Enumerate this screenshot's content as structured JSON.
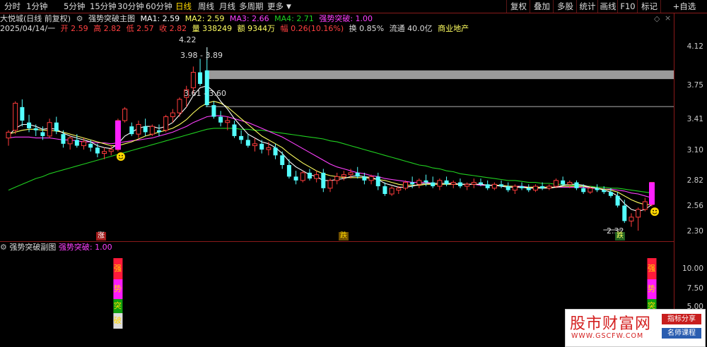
{
  "toolbar": {
    "tabs": [
      "分时",
      "1分钟",
      "5分钟",
      "15分钟",
      "30分钟",
      "60分钟",
      "日线",
      "周线",
      "月线",
      "多周期",
      "更多"
    ],
    "active_tab": "日线",
    "buttons": [
      "复权",
      "叠加",
      "多股",
      "统计",
      "画线",
      "F10",
      "标记",
      "+自选"
    ]
  },
  "header": {
    "stock": "大悦城(日线 前复权)",
    "indicator": "强势突破主图",
    "ma1": "MA1: 2.59",
    "ma2": "MA2: 2.59",
    "ma3": "MA3: 2.66",
    "ma4": "MA4: 2.71",
    "breakout": "强势突破: 1.00"
  },
  "quote": {
    "date": "2025/04/14/一",
    "open": "开 2.59",
    "high": "高 2.82",
    "low": "低 2.57",
    "close": "收 2.82",
    "volume": "量 338249",
    "amount": "额 9344万",
    "change": "幅 0.26(10.16%)",
    "turnover": "换 0.85%",
    "float": "流通 40.0亿",
    "sector": "商业地产"
  },
  "axis": {
    "main_ticks": [
      "4.12",
      "3.75",
      "3.41",
      "3.10",
      "2.82",
      "2.56",
      "2.30"
    ],
    "sub_ticks": [
      "10.00",
      "7.50",
      "5.00"
    ]
  },
  "annotations": {
    "high_label": "4.22",
    "zone1": "3.98 - 3.89",
    "zone2": "3.61 - 3.60",
    "low_label": "2.32",
    "marker_up": "涨",
    "marker_mid": "跌",
    "marker_down": "跌"
  },
  "sub": {
    "title": "强势突破副图",
    "value": "强势突破: 1.00",
    "bar_chars": [
      "强",
      "势",
      "突",
      "破"
    ]
  },
  "watermark": {
    "title": "股市财富网",
    "url": "WWW.GSCFW.COM",
    "tag1": "指标分享",
    "tag2": "名师课程"
  },
  "colors": {
    "up": "#ff3c3c",
    "down": "#54ffff",
    "ma1": "#ffffff",
    "ma2": "#ffff60",
    "ma3": "#ff40ff",
    "ma4": "#20d020",
    "grid_red": "#8a1a1a"
  },
  "chart_data": {
    "type": "candlestick",
    "price_range": [
      2.2,
      4.3
    ],
    "ohlc": [
      [
        3.28,
        3.36,
        3.2,
        3.34
      ],
      [
        3.36,
        3.66,
        3.32,
        3.64
      ],
      [
        3.6,
        3.68,
        3.4,
        3.46
      ],
      [
        3.44,
        3.52,
        3.34,
        3.38
      ],
      [
        3.38,
        3.42,
        3.3,
        3.36
      ],
      [
        3.34,
        3.4,
        3.26,
        3.3
      ],
      [
        3.3,
        3.48,
        3.28,
        3.44
      ],
      [
        3.44,
        3.5,
        3.32,
        3.35
      ],
      [
        3.32,
        3.36,
        3.18,
        3.22
      ],
      [
        3.22,
        3.3,
        3.16,
        3.28
      ],
      [
        3.26,
        3.32,
        3.18,
        3.2
      ],
      [
        3.2,
        3.28,
        3.16,
        3.24
      ],
      [
        3.22,
        3.26,
        3.14,
        3.18
      ],
      [
        3.18,
        3.22,
        3.08,
        3.12
      ],
      [
        3.12,
        3.18,
        3.06,
        3.14
      ],
      [
        3.14,
        3.2,
        3.1,
        3.16
      ],
      [
        3.16,
        3.48,
        3.14,
        3.46
      ],
      [
        3.46,
        3.6,
        3.44,
        3.58
      ],
      [
        3.4,
        3.44,
        3.3,
        3.32
      ],
      [
        3.32,
        3.46,
        3.28,
        3.42
      ],
      [
        3.4,
        3.48,
        3.3,
        3.34
      ],
      [
        3.32,
        3.42,
        3.3,
        3.4
      ],
      [
        3.36,
        3.42,
        3.3,
        3.34
      ],
      [
        3.36,
        3.52,
        3.34,
        3.5
      ],
      [
        3.5,
        3.58,
        3.44,
        3.54
      ],
      [
        3.54,
        3.7,
        3.5,
        3.68
      ],
      [
        3.7,
        3.82,
        3.6,
        3.78
      ],
      [
        3.8,
        4.02,
        3.74,
        3.96
      ],
      [
        3.96,
        4.1,
        3.82,
        3.84
      ],
      [
        3.98,
        4.22,
        3.6,
        3.62
      ],
      [
        3.62,
        3.66,
        3.48,
        3.5
      ],
      [
        3.5,
        3.56,
        3.4,
        3.44
      ],
      [
        3.44,
        3.5,
        3.36,
        3.46
      ],
      [
        3.42,
        3.46,
        3.28,
        3.3
      ],
      [
        3.3,
        3.36,
        3.22,
        3.26
      ],
      [
        3.26,
        3.32,
        3.18,
        3.2
      ],
      [
        3.2,
        3.28,
        3.14,
        3.22
      ],
      [
        3.22,
        3.26,
        3.12,
        3.16
      ],
      [
        3.16,
        3.24,
        3.1,
        3.18
      ],
      [
        3.18,
        3.22,
        3.06,
        3.1
      ],
      [
        3.1,
        3.14,
        2.96,
        3.0
      ],
      [
        3.0,
        3.06,
        2.86,
        2.88
      ],
      [
        2.88,
        2.94,
        2.8,
        2.84
      ],
      [
        2.84,
        2.94,
        2.82,
        2.92
      ],
      [
        2.92,
        2.96,
        2.84,
        2.86
      ],
      [
        2.86,
        2.94,
        2.82,
        2.9
      ],
      [
        2.92,
        2.96,
        2.72,
        2.76
      ],
      [
        2.76,
        2.86,
        2.72,
        2.84
      ],
      [
        2.84,
        2.92,
        2.8,
        2.88
      ],
      [
        2.88,
        2.94,
        2.84,
        2.9
      ],
      [
        2.9,
        2.96,
        2.86,
        2.92
      ],
      [
        2.92,
        2.98,
        2.86,
        2.88
      ],
      [
        2.88,
        2.92,
        2.8,
        2.84
      ],
      [
        2.84,
        2.9,
        2.8,
        2.88
      ],
      [
        2.88,
        2.92,
        2.74,
        2.78
      ],
      [
        2.78,
        2.82,
        2.68,
        2.7
      ],
      [
        2.7,
        2.78,
        2.68,
        2.76
      ],
      [
        2.74,
        2.78,
        2.7,
        2.76
      ],
      [
        2.76,
        2.84,
        2.74,
        2.82
      ],
      [
        2.82,
        2.88,
        2.76,
        2.8
      ],
      [
        2.8,
        2.86,
        2.76,
        2.84
      ],
      [
        2.84,
        2.9,
        2.78,
        2.82
      ],
      [
        2.82,
        2.88,
        2.76,
        2.78
      ],
      [
        2.78,
        2.86,
        2.74,
        2.84
      ],
      [
        2.84,
        2.88,
        2.78,
        2.8
      ],
      [
        2.8,
        2.84,
        2.76,
        2.82
      ],
      [
        2.82,
        2.86,
        2.76,
        2.78
      ],
      [
        2.78,
        2.82,
        2.74,
        2.8
      ],
      [
        2.8,
        2.86,
        2.76,
        2.82
      ],
      [
        2.82,
        2.86,
        2.78,
        2.8
      ],
      [
        2.8,
        2.84,
        2.74,
        2.76
      ],
      [
        2.76,
        2.82,
        2.74,
        2.8
      ],
      [
        2.8,
        2.84,
        2.76,
        2.78
      ],
      [
        2.78,
        2.82,
        2.72,
        2.74
      ],
      [
        2.74,
        2.8,
        2.7,
        2.78
      ],
      [
        2.78,
        2.82,
        2.74,
        2.76
      ],
      [
        2.76,
        2.8,
        2.72,
        2.74
      ],
      [
        2.74,
        2.8,
        2.72,
        2.78
      ],
      [
        2.78,
        2.82,
        2.74,
        2.76
      ],
      [
        2.76,
        2.8,
        2.74,
        2.78
      ],
      [
        2.78,
        2.86,
        2.76,
        2.84
      ],
      [
        2.84,
        2.88,
        2.78,
        2.8
      ],
      [
        2.8,
        2.84,
        2.76,
        2.82
      ],
      [
        2.82,
        2.84,
        2.74,
        2.76
      ],
      [
        2.76,
        2.8,
        2.7,
        2.72
      ],
      [
        2.72,
        2.78,
        2.7,
        2.76
      ],
      [
        2.76,
        2.8,
        2.72,
        2.74
      ],
      [
        2.74,
        2.78,
        2.7,
        2.72
      ],
      [
        2.72,
        2.76,
        2.66,
        2.68
      ],
      [
        2.68,
        2.72,
        2.56,
        2.58
      ],
      [
        2.58,
        2.64,
        2.4,
        2.42
      ],
      [
        2.42,
        2.5,
        2.36,
        2.46
      ],
      [
        2.46,
        2.56,
        2.32,
        2.54
      ],
      [
        2.54,
        2.66,
        2.52,
        2.62
      ],
      [
        2.59,
        2.82,
        2.57,
        2.82
      ]
    ],
    "ma1": [
      3.3,
      3.38,
      3.42,
      3.42,
      3.4,
      3.37,
      3.38,
      3.37,
      3.33,
      3.3,
      3.28,
      3.26,
      3.24,
      3.2,
      3.18,
      3.17,
      3.22,
      3.3,
      3.34,
      3.38,
      3.4,
      3.4,
      3.38,
      3.4,
      3.44,
      3.52,
      3.6,
      3.72,
      3.8,
      3.82,
      3.76,
      3.66,
      3.58,
      3.48,
      3.4,
      3.32,
      3.28,
      3.24,
      3.22,
      3.18,
      3.12,
      3.04,
      2.98,
      2.94,
      2.9,
      2.88,
      2.84,
      2.84,
      2.85,
      2.86,
      2.88,
      2.89,
      2.88,
      2.87,
      2.85,
      2.81,
      2.79,
      2.77,
      2.77,
      2.78,
      2.8,
      2.81,
      2.81,
      2.81,
      2.81,
      2.81,
      2.8,
      2.8,
      2.8,
      2.8,
      2.79,
      2.79,
      2.78,
      2.77,
      2.77,
      2.77,
      2.76,
      2.76,
      2.76,
      2.76,
      2.77,
      2.79,
      2.8,
      2.8,
      2.79,
      2.77,
      2.76,
      2.74,
      2.72,
      2.68,
      2.6,
      2.54,
      2.52,
      2.54,
      2.59
    ],
    "ma2": [
      3.32,
      3.34,
      3.36,
      3.37,
      3.37,
      3.36,
      3.36,
      3.35,
      3.34,
      3.32,
      3.3,
      3.28,
      3.26,
      3.24,
      3.22,
      3.2,
      3.2,
      3.22,
      3.24,
      3.27,
      3.3,
      3.32,
      3.34,
      3.36,
      3.38,
      3.42,
      3.47,
      3.54,
      3.6,
      3.64,
      3.66,
      3.64,
      3.6,
      3.54,
      3.48,
      3.42,
      3.36,
      3.3,
      3.26,
      3.22,
      3.18,
      3.12,
      3.07,
      3.02,
      2.98,
      2.94,
      2.91,
      2.89,
      2.88,
      2.87,
      2.87,
      2.87,
      2.87,
      2.86,
      2.85,
      2.84,
      2.82,
      2.8,
      2.79,
      2.79,
      2.79,
      2.8,
      2.8,
      2.8,
      2.8,
      2.8,
      2.8,
      2.8,
      2.8,
      2.8,
      2.79,
      2.79,
      2.79,
      2.78,
      2.78,
      2.77,
      2.77,
      2.77,
      2.77,
      2.77,
      2.77,
      2.78,
      2.78,
      2.78,
      2.78,
      2.77,
      2.76,
      2.75,
      2.74,
      2.72,
      2.68,
      2.64,
      2.61,
      2.59,
      2.59
    ],
    "ma3": [
      3.28,
      3.29,
      3.29,
      3.29,
      3.28,
      3.28,
      3.28,
      3.27,
      3.26,
      3.26,
      3.25,
      3.24,
      3.24,
      3.23,
      3.23,
      3.22,
      3.23,
      3.24,
      3.25,
      3.26,
      3.27,
      3.28,
      3.3,
      3.32,
      3.34,
      3.37,
      3.4,
      3.44,
      3.47,
      3.5,
      3.51,
      3.51,
      3.5,
      3.48,
      3.46,
      3.44,
      3.41,
      3.38,
      3.35,
      3.32,
      3.29,
      3.25,
      3.21,
      3.17,
      3.13,
      3.09,
      3.05,
      3.01,
      2.98,
      2.96,
      2.94,
      2.92,
      2.91,
      2.89,
      2.88,
      2.86,
      2.85,
      2.84,
      2.83,
      2.82,
      2.82,
      2.82,
      2.81,
      2.81,
      2.81,
      2.8,
      2.8,
      2.8,
      2.8,
      2.79,
      2.79,
      2.79,
      2.79,
      2.78,
      2.78,
      2.78,
      2.77,
      2.77,
      2.77,
      2.77,
      2.77,
      2.77,
      2.77,
      2.77,
      2.77,
      2.76,
      2.76,
      2.75,
      2.75,
      2.74,
      2.73,
      2.71,
      2.7,
      2.68,
      2.66
    ],
    "ma4": [
      2.74,
      2.77,
      2.8,
      2.83,
      2.86,
      2.88,
      2.91,
      2.93,
      2.95,
      2.97,
      2.99,
      3.01,
      3.03,
      3.05,
      3.07,
      3.09,
      3.11,
      3.13,
      3.15,
      3.17,
      3.19,
      3.21,
      3.23,
      3.25,
      3.27,
      3.29,
      3.31,
      3.33,
      3.35,
      3.37,
      3.38,
      3.38,
      3.38,
      3.38,
      3.37,
      3.37,
      3.36,
      3.36,
      3.35,
      3.34,
      3.33,
      3.32,
      3.31,
      3.3,
      3.29,
      3.28,
      3.27,
      3.25,
      3.24,
      3.22,
      3.2,
      3.18,
      3.16,
      3.14,
      3.12,
      3.1,
      3.08,
      3.06,
      3.04,
      3.02,
      3.0,
      2.99,
      2.97,
      2.96,
      2.94,
      2.93,
      2.91,
      2.9,
      2.89,
      2.88,
      2.87,
      2.86,
      2.85,
      2.84,
      2.84,
      2.83,
      2.82,
      2.82,
      2.81,
      2.81,
      2.8,
      2.8,
      2.79,
      2.79,
      2.78,
      2.78,
      2.77,
      2.77,
      2.76,
      2.76,
      2.75,
      2.74,
      2.73,
      2.72,
      2.71
    ],
    "signal_bars": [
      16,
      94
    ]
  }
}
